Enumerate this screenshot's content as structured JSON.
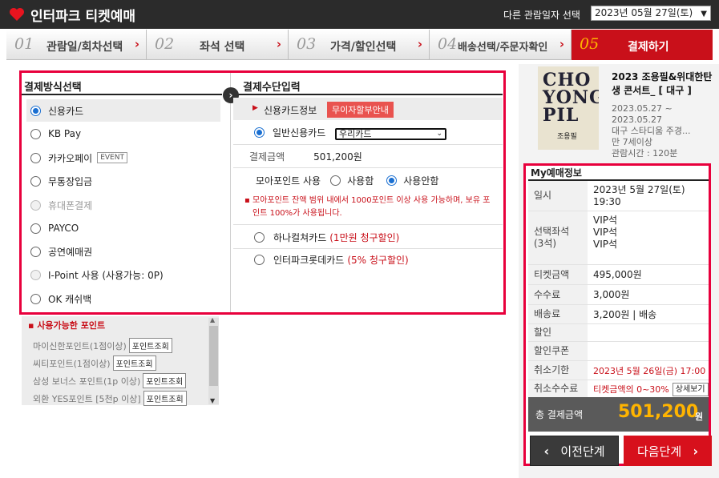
{
  "header": {
    "brand": "인터파크 티켓예매",
    "date_label": "다른 관람일자 선택",
    "date_value": "2023년 05월 27일(토)"
  },
  "steps": [
    {
      "num": "01",
      "label": "관람일/회차선택"
    },
    {
      "num": "02",
      "label": "좌석 선택"
    },
    {
      "num": "03",
      "label": "가격/할인선택"
    },
    {
      "num": "04",
      "label": "배송선택/주문자확인"
    },
    {
      "num": "05",
      "label": "결제하기"
    }
  ],
  "payment_method": {
    "title": "결제방식선택",
    "event_badge": "EVENT",
    "items": [
      {
        "label": "신용카드"
      },
      {
        "label": "KB Pay"
      },
      {
        "label": "카카오페이"
      },
      {
        "label": "무통장입금"
      },
      {
        "label": "휴대폰결제"
      },
      {
        "label": "PAYCO"
      },
      {
        "label": "공연예매권"
      },
      {
        "label": "I-Point 사용 (사용가능: 0P)"
      },
      {
        "label": "OK 캐쉬백"
      }
    ]
  },
  "payment_input": {
    "title": "결제수단입력",
    "card_info": "신용카드정보",
    "installment_badge": "무이자할부안내",
    "card_type": "일반신용카드",
    "card_select": "우리카드",
    "amount_label": "결제금액",
    "amount": "501,200원",
    "moa_label": "모아포인트 사용",
    "moa_use": "사용함",
    "moa_nouse": "사용안함",
    "note": "모아포인트 잔액 범위 내에서 1000포인트 이상 사용 가능하며, 보유 포인트 100%가 사용됩니다.",
    "hana_card": "하나컬쳐카드",
    "hana_discount": "(1만원 청구할인)",
    "lotte_card": "인터파크롯데카드",
    "lotte_discount": "(5% 청구할인)"
  },
  "points": {
    "title": "사용가능한 포인트",
    "button": "포인트조회",
    "rows": [
      {
        "label": "마이신한포인트(1점이상)"
      },
      {
        "label": "씨티포인트(1점이상)"
      },
      {
        "label": "삼성 보너스 포인트(1p 이상)"
      },
      {
        "label": "외환 YES포인트 [5천p 이상]"
      }
    ]
  },
  "show": {
    "poster_title": "CHO YONG PIL",
    "poster_sub": "조용필",
    "title": "2023 조용필&위대한탄생 콘서트_ [ 대구 ]",
    "date_range": "2023.05.27 ~ 2023.05.27",
    "venue": "대구 스타디움 주경...",
    "age": "만 7세이상",
    "runtime": "관람시간 : 120분"
  },
  "my_info": {
    "title": "My예매정보",
    "date_k": "일시",
    "date_v1": "2023년 5월 27일(토)",
    "date_v2": "19:30",
    "seat_k1": "선택좌석",
    "seat_k2": "(3석)",
    "seats": [
      "VIP석",
      "VIP석",
      "VIP석"
    ],
    "ticket_k": "티켓금액",
    "ticket_v": "495,000원",
    "fee_k": "수수료",
    "fee_v": "3,000원",
    "ship_k": "배송료",
    "ship_v": "3,200원 | 배송",
    "disc_k": "할인",
    "coupon_k": "할인쿠폰",
    "cancel_k": "취소기한",
    "cancel_v": "2023년 5월 26일(금) 17:00",
    "cancelfee_k": "취소수수료",
    "cancelfee_v": "티켓금액의 0~30%",
    "detail_btn": "상세보기",
    "total_k": "총 결제금액",
    "total_v": "501,200",
    "total_unit": "원"
  },
  "nav": {
    "prev": "이전단계",
    "next": "다음단계"
  }
}
